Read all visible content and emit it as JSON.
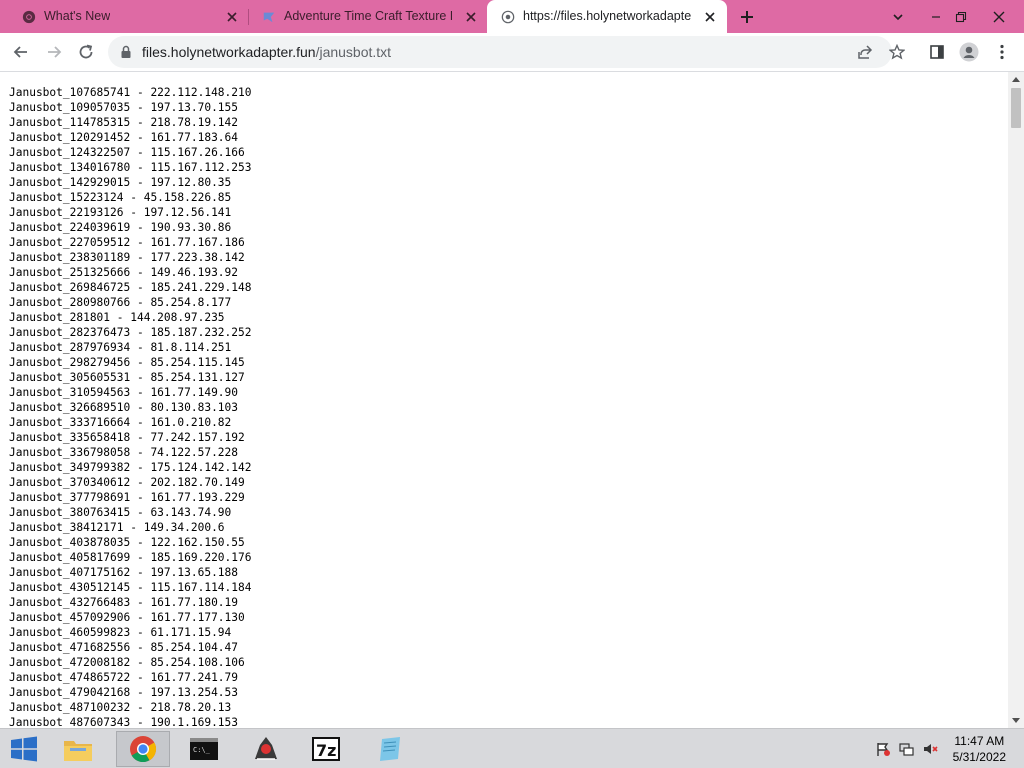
{
  "browser": {
    "tabs": [
      {
        "title": "What's New",
        "active": false,
        "icon": "chrome-icon"
      },
      {
        "title": "Adventure Time Craft Texture Pa",
        "active": false,
        "icon": "texture-pack-icon"
      },
      {
        "title": "https://files.holynetworkadapter.f",
        "active": true,
        "icon": "globe-icon"
      }
    ],
    "address": {
      "host": "files.holynetworkadapter.fun",
      "path": "/janusbot.txt"
    },
    "accent": "#de6aa4"
  },
  "file": {
    "lines": [
      "Janusbot_107685741 - 222.112.148.210",
      "Janusbot_109057035 - 197.13.70.155",
      "Janusbot_114785315 - 218.78.19.142",
      "Janusbot_120291452 - 161.77.183.64",
      "Janusbot_124322507 - 115.167.26.166",
      "Janusbot_134016780 - 115.167.112.253",
      "Janusbot_142929015 - 197.12.80.35",
      "Janusbot_15223124 - 45.158.226.85",
      "Janusbot_22193126 - 197.12.56.141",
      "Janusbot_224039619 - 190.93.30.86",
      "Janusbot_227059512 - 161.77.167.186",
      "Janusbot_238301189 - 177.223.38.142",
      "Janusbot_251325666 - 149.46.193.92",
      "Janusbot_269846725 - 185.241.229.148",
      "Janusbot_280980766 - 85.254.8.177",
      "Janusbot_281801 - 144.208.97.235",
      "Janusbot_282376473 - 185.187.232.252",
      "Janusbot_287976934 - 81.8.114.251",
      "Janusbot_298279456 - 85.254.115.145",
      "Janusbot_305605531 - 85.254.131.127",
      "Janusbot_310594563 - 161.77.149.90",
      "Janusbot_326689510 - 80.130.83.103",
      "Janusbot_333716664 - 161.0.210.82",
      "Janusbot_335658418 - 77.242.157.192",
      "Janusbot_336798058 - 74.122.57.228",
      "Janusbot_349799382 - 175.124.142.142",
      "Janusbot_370340612 - 202.182.70.149",
      "Janusbot_377798691 - 161.77.193.229",
      "Janusbot_380763415 - 63.143.74.90",
      "Janusbot_38412171 - 149.34.200.6",
      "Janusbot_403878035 - 122.162.150.55",
      "Janusbot_405817699 - 185.169.220.176",
      "Janusbot_407175162 - 197.13.65.188",
      "Janusbot_430512145 - 115.167.114.184",
      "Janusbot_432766483 - 161.77.180.19",
      "Janusbot_457092906 - 161.77.177.130",
      "Janusbot_460599823 - 61.171.15.94",
      "Janusbot_471682556 - 85.254.104.47",
      "Janusbot_472008182 - 85.254.108.106",
      "Janusbot_474865722 - 161.77.241.79",
      "Janusbot_479042168 - 197.13.254.53",
      "Janusbot_487100232 - 218.78.20.13",
      "Janusbot_487607343 - 190.1.169.153"
    ]
  },
  "taskbar": {
    "apps": [
      "start-icon",
      "file-explorer-icon",
      "chrome-icon",
      "terminal-icon",
      "java-app-icon",
      "7zip-icon",
      "notepad-icon"
    ],
    "clock": {
      "time": "11:47 AM",
      "date": "5/31/2022"
    }
  }
}
